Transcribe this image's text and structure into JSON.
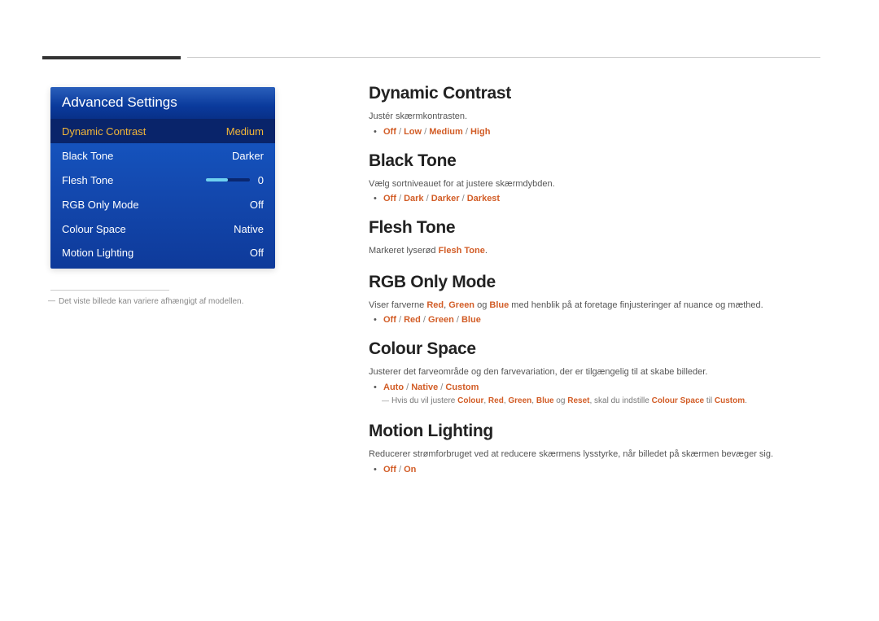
{
  "panel": {
    "title": "Advanced Settings",
    "rows": [
      {
        "label": "Dynamic Contrast",
        "value": "Medium",
        "selected": true
      },
      {
        "label": "Black Tone",
        "value": "Darker"
      },
      {
        "label": "Flesh Tone",
        "value": "0",
        "slider": true
      },
      {
        "label": "RGB Only Mode",
        "value": "Off"
      },
      {
        "label": "Colour Space",
        "value": "Native"
      },
      {
        "label": "Motion Lighting",
        "value": "Off"
      }
    ]
  },
  "footnote": "Det viste billede kan variere afhængigt af modellen.",
  "sections": {
    "dynamic_contrast": {
      "title": "Dynamic Contrast",
      "desc": "Justér skærmkontrasten.",
      "options": [
        "Off",
        "Low",
        "Medium",
        "High"
      ]
    },
    "black_tone": {
      "title": "Black Tone",
      "desc": "Vælg sortniveauet for at justere skærmdybden.",
      "options": [
        "Off",
        "Dark",
        "Darker",
        "Darkest"
      ]
    },
    "flesh_tone": {
      "title": "Flesh Tone",
      "desc_pre": "Markeret lyserød ",
      "desc_term": "Flesh Tone",
      "desc_post": "."
    },
    "rgb_only": {
      "title": "RGB Only Mode",
      "desc_pre": "Viser farverne ",
      "r": "Red",
      "g": "Green",
      "b": "Blue",
      "desc_mid1": ", ",
      "desc_mid2": " og ",
      "desc_post": " med henblik på at foretage finjusteringer af nuance og mæthed.",
      "options": [
        "Off",
        "Red",
        "Green",
        "Blue"
      ]
    },
    "colour_space": {
      "title": "Colour Space",
      "desc": "Justerer det farveområde og den farvevariation, der er tilgængelig til at skabe billeder.",
      "options": [
        "Auto",
        "Native",
        "Custom"
      ],
      "note_pre": "Hvis du vil justere ",
      "note_terms": [
        "Colour",
        "Red",
        "Green",
        "Blue",
        "Reset"
      ],
      "note_sep1": ", ",
      "note_og": " og ",
      "note_mid": ", skal du indstille ",
      "note_cs": "Colour Space",
      "note_til": " til ",
      "note_custom": "Custom",
      "note_end": "."
    },
    "motion_lighting": {
      "title": "Motion Lighting",
      "desc": "Reducerer strømforbruget ved at reducere skærmens lysstyrke, når billedet på skærmen bevæger sig.",
      "options": [
        "Off",
        "On"
      ]
    }
  }
}
